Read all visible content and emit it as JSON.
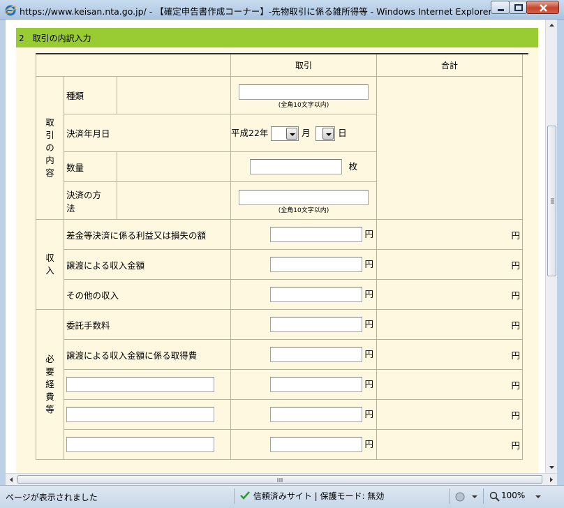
{
  "window": {
    "title": "https://www.keisan.nta.go.jp/ - 【確定申告書作成コーナー】-先物取引に係る雑所得等 - Windows Internet Explorer"
  },
  "section": {
    "title": "2　取引の内訳入力"
  },
  "table": {
    "header_trade": "取引",
    "header_total": "合計",
    "group_content": [
      "取",
      "引",
      "の",
      "内",
      "容"
    ],
    "group_income": [
      "収",
      "入"
    ],
    "group_expense": [
      "必",
      "要",
      "経",
      "費",
      "等"
    ],
    "row_kind": "種類",
    "row_date": "決済年月日",
    "row_qty": "数量",
    "row_method_line1": "決済の方",
    "row_method_line2": "法",
    "note_fullwidth": "(全角10文字以内)",
    "era_year": "平成22年",
    "month_label": "月",
    "day_label": "日",
    "qty_unit": "枚",
    "income_rows": [
      "差金等決済に係る利益又は損失の額",
      "譲渡による収入金額",
      "その他の収入"
    ],
    "expense_rows": [
      "委託手数料",
      "譲渡による収入金額に係る取得費"
    ],
    "yen": "円"
  },
  "statusbar": {
    "text": "ページが表示されました",
    "trust": "信頼済みサイト | 保護モード: 無効",
    "zoom": "100%"
  },
  "colors": {
    "section_bar": "#99cc33",
    "form_bg": "#fff8e1",
    "titlebar": "#aac4e2"
  }
}
